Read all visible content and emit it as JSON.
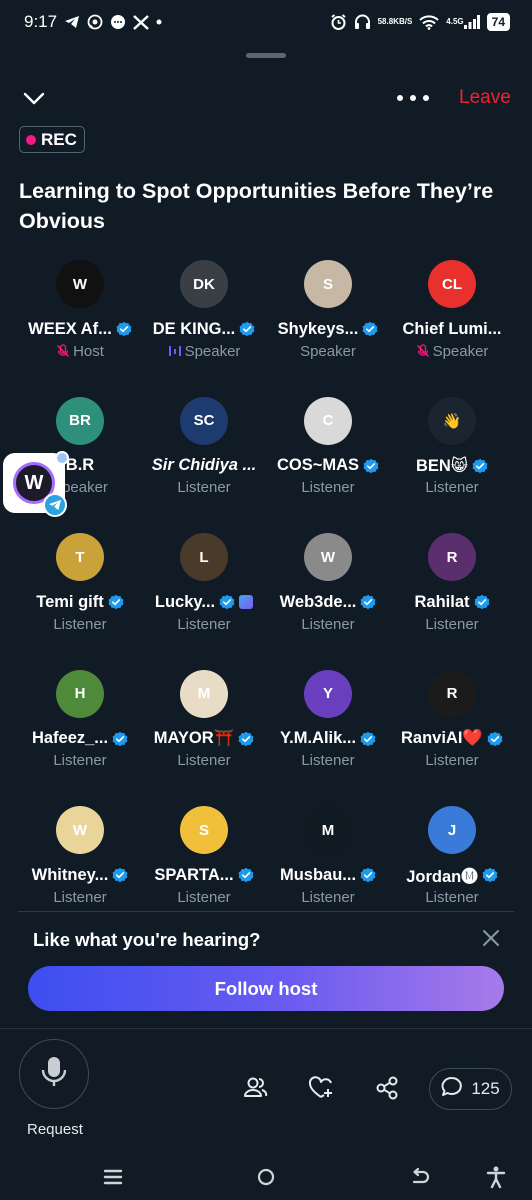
{
  "status_bar": {
    "time": "9:17",
    "notification_icons": [
      "telegram-icon",
      "whatsapp-icon",
      "chat-bubble-icon",
      "x-logo-icon",
      "dot-icon"
    ],
    "net_speed": "58.8",
    "net_unit": "KB/S",
    "network": "4.5G",
    "battery": "74",
    "system_icons": [
      "alarm-icon",
      "headphones-icon",
      "wifi-icon",
      "signal-icon"
    ]
  },
  "header": {
    "leave_label": "Leave",
    "rec_label": "REC"
  },
  "space": {
    "title": "Learning to Spot Opportunities Before They’re Obvious"
  },
  "participants": [
    {
      "name": "WEEX Af...",
      "role": "Host",
      "role_icon": "muted-mic-icon",
      "verified": true,
      "color": "#111111",
      "initials": "W"
    },
    {
      "name": "DE KING...",
      "role": "Speaker",
      "role_icon": "speaking-bars-icon",
      "verified": true,
      "color": "#3a3f46",
      "initials": "DK"
    },
    {
      "name": "Shykeys...",
      "role": "Speaker",
      "role_icon": "",
      "verified": true,
      "color": "#c7b7a5",
      "initials": "S"
    },
    {
      "name": "Chief Lumi...",
      "role": "Speaker",
      "role_icon": "muted-mic-icon",
      "verified": false,
      "color": "#e8312d",
      "initials": "CL"
    },
    {
      "name": "B.R",
      "role": "Speaker",
      "role_icon": "",
      "verified": false,
      "color": "#2e8f7a",
      "initials": "BR"
    },
    {
      "name": "Sir Chidiya ...",
      "role": "Listener",
      "role_icon": "",
      "verified": false,
      "color": "#1d3b6e",
      "initials": "SC",
      "italic": true
    },
    {
      "name": "COS~MAS",
      "role": "Listener",
      "role_icon": "",
      "verified": true,
      "color": "#d9d9d9",
      "initials": "C"
    },
    {
      "name": "BEN😸",
      "role": "Listener",
      "role_icon": "",
      "verified": true,
      "color": "#1a2530",
      "initials": "👋"
    },
    {
      "name": "Temi gift",
      "role": "Listener",
      "role_icon": "",
      "verified": true,
      "color": "#c9a23a",
      "initials": "T"
    },
    {
      "name": "Lucky...",
      "role": "Listener",
      "role_icon": "",
      "verified": true,
      "color": "#4a3a2a",
      "initials": "L",
      "extra_badge": true
    },
    {
      "name": "Web3de...",
      "role": "Listener",
      "role_icon": "",
      "verified": true,
      "color": "#8a8a8a",
      "initials": "W"
    },
    {
      "name": "Rahilat",
      "role": "Listener",
      "role_icon": "",
      "verified": true,
      "color": "#5b2f6e",
      "initials": "R"
    },
    {
      "name": "Hafeez_...",
      "role": "Listener",
      "role_icon": "",
      "verified": true,
      "color": "#4f8a3a",
      "initials": "H"
    },
    {
      "name": "MAYOR⛩️",
      "role": "Listener",
      "role_icon": "",
      "verified": true,
      "color": "#e8dcc6",
      "initials": "M"
    },
    {
      "name": "Y.M.Alik...",
      "role": "Listener",
      "role_icon": "",
      "verified": true,
      "color": "#6a3fbf",
      "initials": "Y"
    },
    {
      "name": "RanviAI❤️",
      "role": "Listener",
      "role_icon": "",
      "verified": true,
      "color": "#1b1b1b",
      "initials": "R"
    },
    {
      "name": "Whitney...",
      "role": "Listener",
      "role_icon": "",
      "verified": true,
      "color": "#e9d49a",
      "initials": "W"
    },
    {
      "name": "SPARTA...",
      "role": "Listener",
      "role_icon": "",
      "verified": true,
      "color": "#f0c03a",
      "initials": "S"
    },
    {
      "name": "Musbau...",
      "role": "Listener",
      "role_icon": "",
      "verified": true,
      "color": "#0f1a22",
      "initials": "M"
    },
    {
      "name": "Jordan🅜",
      "role": "Listener",
      "role_icon": "",
      "verified": true,
      "color": "#3a7ad9",
      "initials": "J"
    }
  ],
  "prompt": {
    "text": "Like what you're hearing?",
    "button_label": "Follow host"
  },
  "controls": {
    "request_label": "Request",
    "comments_count": "125",
    "icons": [
      "people-icon",
      "heart-plus-icon",
      "share-icon",
      "comment-icon",
      "microphone-icon"
    ]
  },
  "nav_icons": [
    "recents-icon",
    "home-icon",
    "back-icon",
    "accessibility-icon"
  ],
  "colors": {
    "background": "#111b26",
    "leave": "#f4212e",
    "rec_dot": "#f91880",
    "verified": "#1d9bf0",
    "muted_text": "#8b98a5",
    "follow_gradient_start": "#3d4ef0",
    "follow_gradient_end": "#a77ae9"
  }
}
